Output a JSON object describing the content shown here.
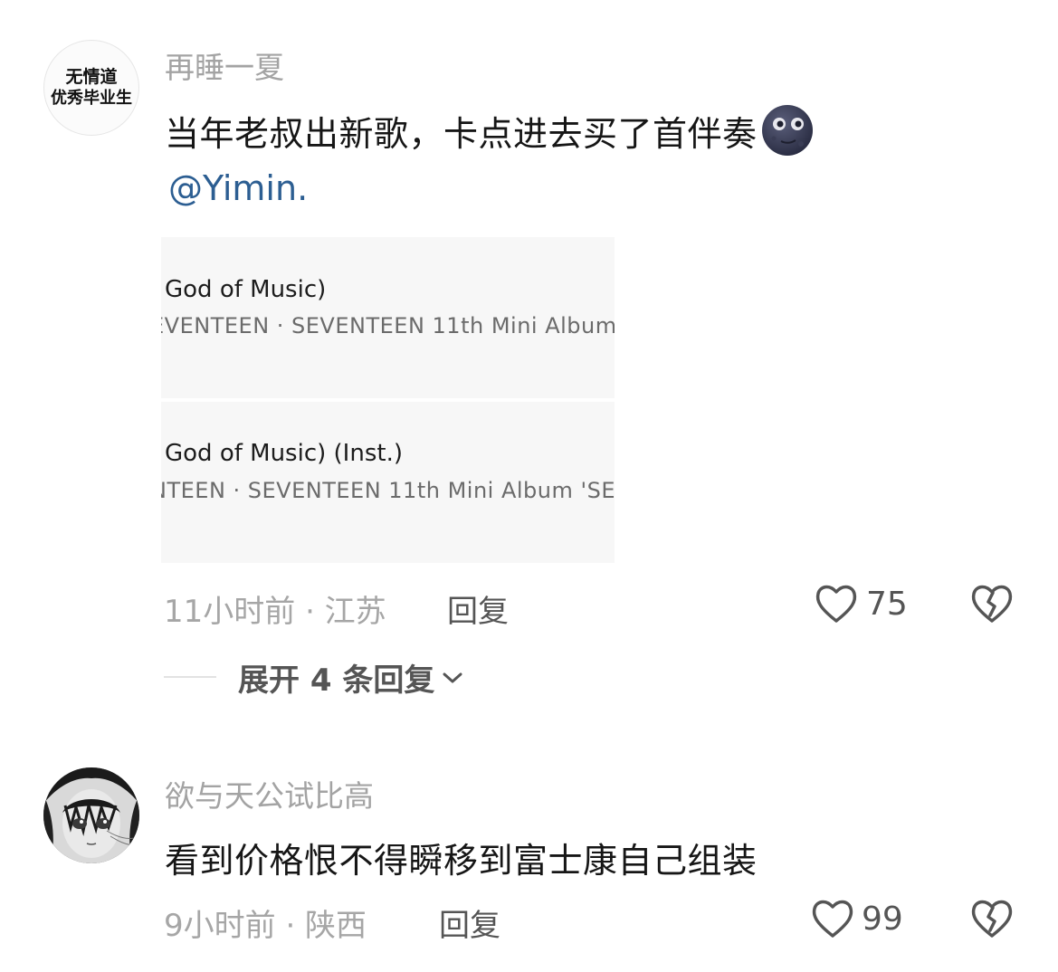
{
  "comments": [
    {
      "avatar_lines": [
        "无情道",
        "优秀毕业生"
      ],
      "username": "再睡一夏",
      "text": "当年老叔出新歌，卡点进去买了首伴奏",
      "emoji": "new-moon-face",
      "mention": "@Yimin.",
      "tracks": [
        {
          "title": "God of Music)",
          "subtitle": "EVENTEEN · SEVENTEEN 11th Mini Album"
        },
        {
          "title": "God of Music) (Inst.)",
          "subtitle": "NTEEN · SEVENTEEN 11th Mini Album 'SE"
        }
      ],
      "time_location": "11小时前 · 江苏",
      "reply_label": "回复",
      "likes": "75",
      "expand_label": "展开 4 条回复"
    },
    {
      "username": "欲与天公试比高",
      "text": "看到价格恨不得瞬移到富士康自己组装",
      "time_location": "9小时前 · 陕西",
      "reply_label": "回复",
      "likes": "99"
    }
  ],
  "icons": {
    "like": "heart-outline-icon",
    "dislike": "broken-heart-icon",
    "expand": "chevron-down-icon"
  },
  "colors": {
    "username": "#a3a3a3",
    "mention": "#2c5e92",
    "meta": "#a6a6a6",
    "text": "#161616"
  }
}
